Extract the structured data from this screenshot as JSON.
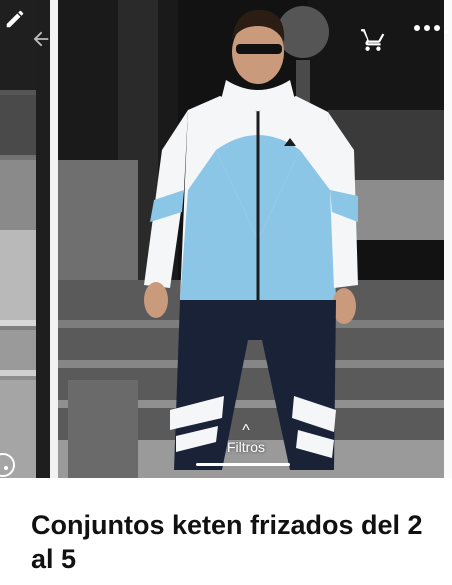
{
  "header": {
    "edit_icon": "pencil-icon",
    "back_icon": "back-arrow-icon",
    "cart_icon": "cart-icon",
    "menu_icon": "more-dots-icon"
  },
  "gallery": {
    "image_alt_subject": "man in jacket and track pants"
  },
  "filters": {
    "label": "Filtros",
    "chevron": "^"
  },
  "product": {
    "title": "Conjuntos keten frizados del 2 al 5"
  },
  "colors": {
    "jacket_blue": "#8cc6e6",
    "jacket_white": "#f4f6f8",
    "pants_navy": "#1a2238",
    "background_dark": "#0c0c0c"
  }
}
